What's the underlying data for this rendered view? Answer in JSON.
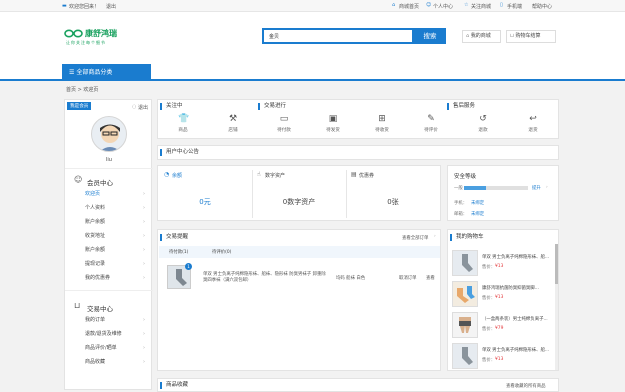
{
  "topbar": {
    "welcome": "欢迎您回来！",
    "logout": "退出",
    "links": [
      "商城首页",
      "个人中心",
      "关注商城",
      "手机端",
      "帮助中心"
    ]
  },
  "logo": {
    "text": "康舒鸿瑞",
    "slogan": "让你关注每个细节",
    "icon": "logo-icon"
  },
  "search": {
    "value": "金贝",
    "button": "搜索"
  },
  "header_links": {
    "my_mall": "我的商城",
    "cart": "购物车结算"
  },
  "nav": {
    "all_categories": "全部商品分类"
  },
  "breadcrumb": {
    "home": "首页",
    "sep": ">",
    "current": "欢迎页"
  },
  "sidebar": {
    "badge": "我是会员",
    "logout": "退出",
    "username": "liu",
    "group1": {
      "title": "会员中心",
      "items": [
        "欢迎页",
        "个人资料",
        "账户余额",
        "收货地址",
        "账户余额",
        "提现记录",
        "我的优惠券"
      ]
    },
    "group2": {
      "title": "交易中心",
      "items": [
        "我的订单",
        "退款/退货及维修",
        "商品评价/晒单",
        "商品收藏"
      ]
    }
  },
  "focus": {
    "title": "关注中",
    "items": [
      "商品",
      "店铺"
    ]
  },
  "trade": {
    "title": "交易进行",
    "items": [
      "待付款",
      "待发货",
      "待收货",
      "待评价"
    ]
  },
  "service": {
    "title": "售后服务",
    "items": [
      "退款",
      "退货"
    ]
  },
  "announce": {
    "title": "用户中心公告"
  },
  "assets": {
    "balance_label": "余额",
    "balance_value": "0元",
    "digital_label": "数字资产",
    "digital_value": "0数字资产",
    "coupon_label": "优惠券",
    "coupon_value": "0张"
  },
  "security": {
    "title": "安全等级",
    "level": "一般",
    "progress": 0.35,
    "upgrade": "提升",
    "phone_label": "手机：",
    "phone_value": "未绑定",
    "email_label": "邮箱：",
    "email_value": "未绑定"
  },
  "orders": {
    "title": "交易提醒",
    "view_all": "查看全部订单",
    "tabs": [
      "待付款(1)",
      "待评价(0)"
    ],
    "row": {
      "count": "1",
      "name": "单双 男士负离子纯棉隐形袜、船袜、隐形袜 防臭男袜子 卸重除臭四季袜（满六双包邮）",
      "spec": "均码 船袜 白色",
      "cancel": "取消订单",
      "view": "查看"
    }
  },
  "cart": {
    "title": "我的购物车",
    "price_label": "售价：",
    "items": [
      {
        "name": "单双 男士负离子纯棉隐形袜、船...",
        "price": "¥13"
      },
      {
        "name": "康舒鸿瑞抗菌防臭抑菌臭脚...",
        "price": "¥13"
      },
      {
        "name": "（一盒两条装）男士纯棉负离子...",
        "price": "¥79"
      },
      {
        "name": "单双 男士负离子纯棉隐形袜、船...",
        "price": "¥13"
      }
    ]
  },
  "favorites": {
    "title": "商品收藏",
    "view_all": "查看收藏的所有商品"
  },
  "colors": {
    "accent": "#1a7ccf",
    "price": "#e4393c",
    "logo_green": "#19a15f"
  }
}
